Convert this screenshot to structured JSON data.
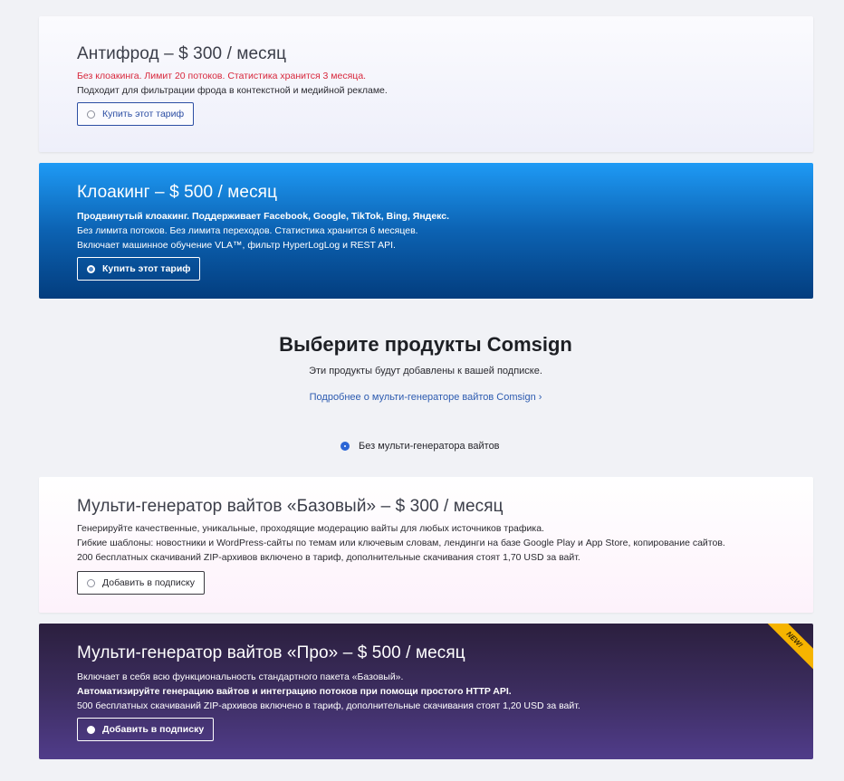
{
  "plans": {
    "antifraud": {
      "title": "Антифрод – $ 300 / месяц",
      "lines": [
        "Без клоакинга. Лимит 20 потоков. Статистика хранится 3 месяца.",
        "Подходит для фильтрации фрода в контекстной и медийной рекламе."
      ],
      "button": "Купить этот тариф"
    },
    "cloaking": {
      "title": "Клоакинг – $ 500 / месяц",
      "lines": [
        "Продвинутый клоакинг. Поддерживает Facebook, Google, TikTok, Bing, Яндекс.",
        "Без лимита потоков. Без лимита переходов. Статистика хранится 6 месяцев.",
        "Включает машинное обучение VLA™, фильтр HyperLogLog и REST API."
      ],
      "button": "Купить этот тариф"
    }
  },
  "products": {
    "heading": "Выберите продукты Comsign",
    "subtitle": "Эти продукты будут добавлены к вашей подписке.",
    "link": "Подробнее о мульти-генераторе вайтов Comsign",
    "link_chevron": "›",
    "no_generator_label": "Без мульти-генератора вайтов"
  },
  "generators": {
    "base": {
      "title": "Мульти-генератор вайтов «Базовый» – $ 300 / месяц",
      "lines": [
        "Генерируйте качественные, уникальные, проходящие модерацию вайты для любых источников трафика.",
        "Гибкие шаблоны: новостники и WordPress-сайты по темам или ключевым словам, лендинги на базе Google Play и App Store, копирование сайтов.",
        "200 бесплатных скачиваний ZIP-архивов включено в тариф, дополнительные скачивания стоят 1,70 USD за вайт."
      ],
      "button": "Добавить в подписку"
    },
    "pro": {
      "title": "Мульти-генератор вайтов «Про» – $ 500 / месяц",
      "lines": [
        "Включает в себя всю функциональность стандартного пакета «Базовый».",
        "Автоматизируйте генерацию вайтов и интеграцию потоков при помощи простого HTTP API.",
        "500 бесплатных скачиваний ZIP-архивов включено в тариф, дополнительные скачивания стоят 1,20 USD за вайт."
      ],
      "button": "Добавить в подписку",
      "badge": "NEW!"
    }
  },
  "colors": {
    "page_background": "#f1f2f6",
    "link_blue": "#2d5bb0",
    "warning_red": "#d8283c",
    "badge_yellow": "#f6b400"
  }
}
